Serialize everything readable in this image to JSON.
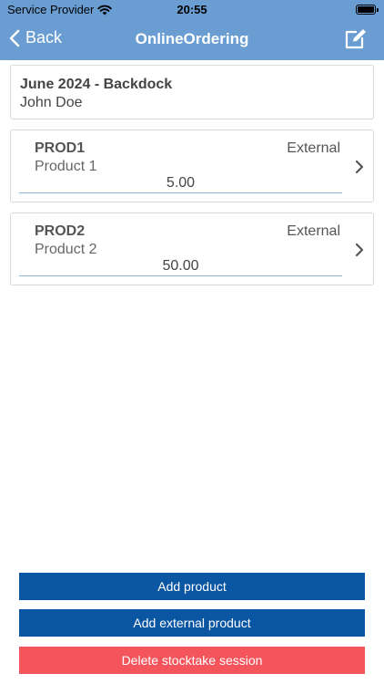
{
  "status_bar": {
    "carrier": "Service Provider",
    "time": "20:55"
  },
  "nav": {
    "back_label": "Back",
    "title": "OnlineOrdering",
    "bar_color": "#6a9ed3"
  },
  "session": {
    "title": "June 2024 - Backdock",
    "user": "John Doe"
  },
  "products": [
    {
      "code": "PROD1",
      "name": "Product 1",
      "type": "External",
      "quantity": "5.00"
    },
    {
      "code": "PROD2",
      "name": "Product 2",
      "type": "External",
      "quantity": "50.00"
    }
  ],
  "actions": {
    "add_product": "Add product",
    "add_external_product": "Add external product",
    "delete_session": "Delete stocktake session",
    "primary_color": "#0b56a3",
    "danger_color": "#f4545b"
  },
  "icons": {
    "wifi": "wifi-icon",
    "battery": "battery-icon",
    "back": "chevron-left-icon",
    "edit": "edit-icon",
    "row_chevron": "chevron-right-icon"
  }
}
